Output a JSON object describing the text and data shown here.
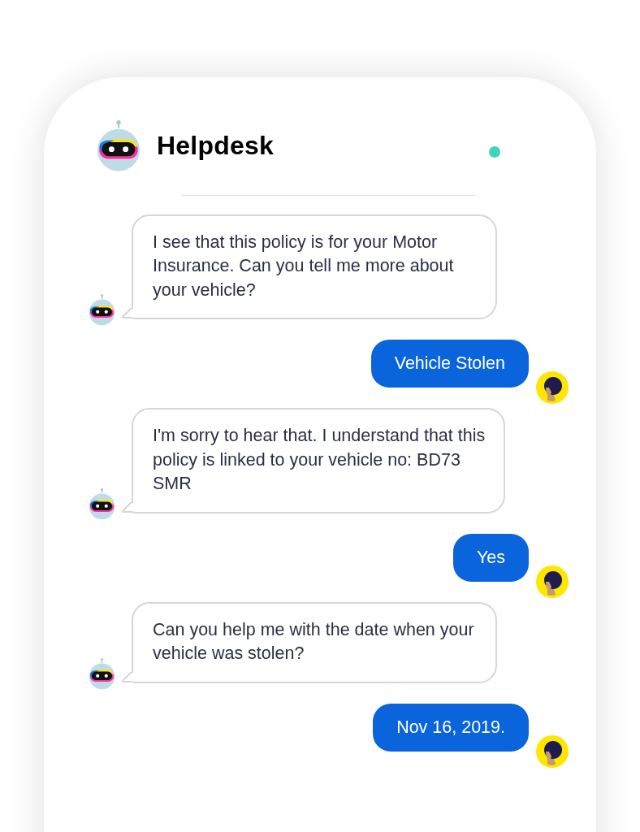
{
  "header": {
    "title": "Helpdesk",
    "online": true
  },
  "messages": [
    {
      "kind": "bot",
      "text": "I see that this policy is for your Motor Insurance. Can you tell me more about your vehicle?"
    },
    {
      "kind": "user",
      "text": "Vehicle Stolen"
    },
    {
      "kind": "bot",
      "text": "I'm sorry to hear that. I understand that this policy is linked to your vehicle no: BD73 SMR"
    },
    {
      "kind": "user",
      "text": "Yes"
    },
    {
      "kind": "bot",
      "text": "Can you help me with the date when your vehicle was stolen?"
    },
    {
      "kind": "user",
      "text": "Nov 16, 2019."
    }
  ]
}
